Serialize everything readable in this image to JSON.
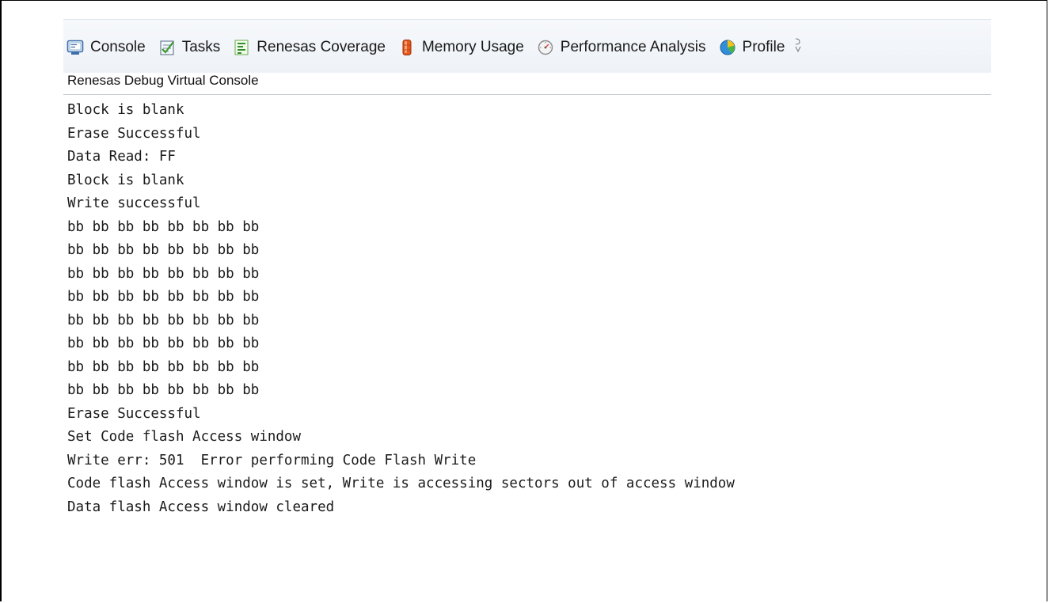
{
  "tabs": [
    {
      "label": "Console",
      "icon": "console-icon"
    },
    {
      "label": "Tasks",
      "icon": "tasks-icon"
    },
    {
      "label": "Renesas Coverage",
      "icon": "coverage-icon"
    },
    {
      "label": "Memory Usage",
      "icon": "memory-usage-icon"
    },
    {
      "label": "Performance Analysis",
      "icon": "performance-icon"
    },
    {
      "label": "Profile",
      "icon": "profile-icon"
    }
  ],
  "console": {
    "title": "Renesas Debug Virtual Console",
    "lines": [
      "Block is blank",
      "Erase Successful",
      "Data Read: FF",
      "Block is blank",
      "Write successful",
      "bb bb bb bb bb bb bb bb",
      "bb bb bb bb bb bb bb bb",
      "bb bb bb bb bb bb bb bb",
      "bb bb bb bb bb bb bb bb",
      "bb bb bb bb bb bb bb bb",
      "bb bb bb bb bb bb bb bb",
      "bb bb bb bb bb bb bb bb",
      "bb bb bb bb bb bb bb bb",
      "Erase Successful",
      "Set Code flash Access window",
      "Write err: 501  Error performing Code Flash Write",
      "Code flash Access window is set, Write is accessing sectors out of access window",
      "Data flash Access window cleared"
    ]
  }
}
